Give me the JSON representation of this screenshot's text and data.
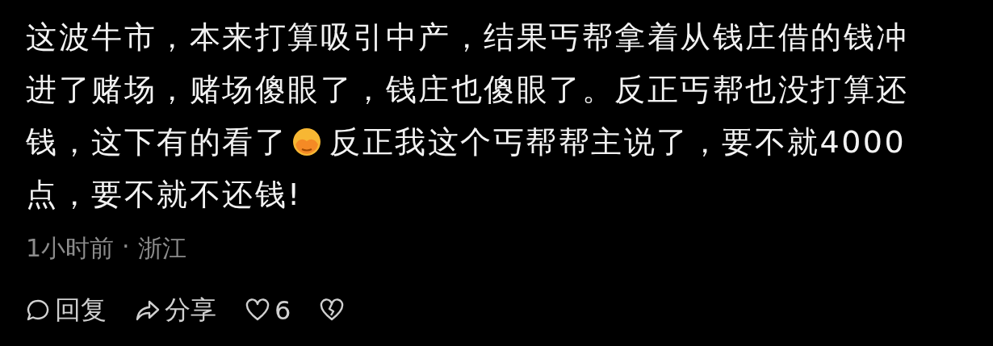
{
  "comment": {
    "lines": [
      {
        "text": "这波牛市，本来打算吸引中产，结果丐帮拿着从钱庄借的钱冲"
      },
      {
        "text": "进了赌场，赌场傻眼了，钱庄也傻眼了。反正丐帮也没打算还"
      },
      {
        "text": "钱，这下有的看了",
        "emoji": true,
        "text_after": "反正我这个丐帮帮主说了，要不就4000"
      },
      {
        "text": "点，要不就不还钱!"
      }
    ]
  },
  "meta": {
    "time": "1小时前",
    "separator": "·",
    "location": "浙江"
  },
  "actions": [
    {
      "kind": "reply",
      "label": "回复"
    },
    {
      "kind": "share",
      "label": "分享"
    },
    {
      "kind": "like",
      "label": "6"
    },
    {
      "kind": "dislike"
    }
  ]
}
